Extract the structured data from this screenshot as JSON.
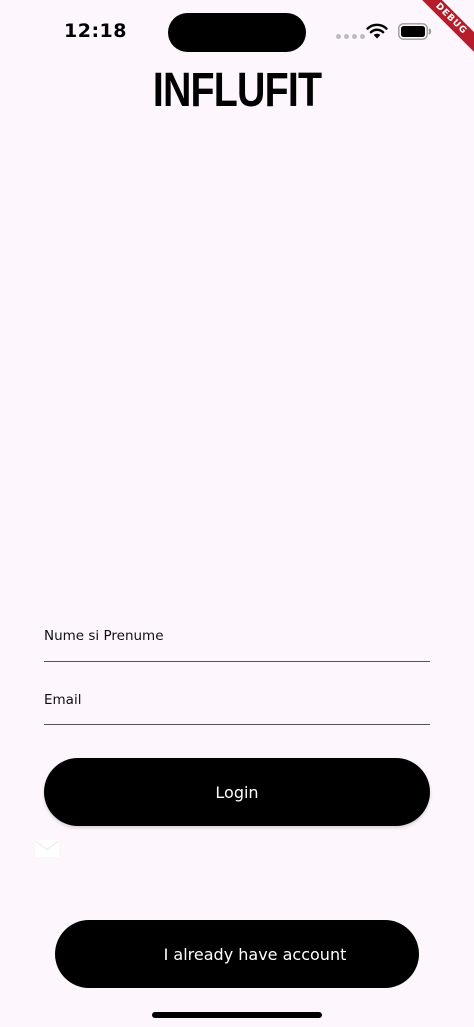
{
  "status_bar": {
    "time": "12:18"
  },
  "debug_banner": {
    "label": "DEBUG",
    "color": "#b71c2b"
  },
  "app": {
    "logo": "INFLUFIT"
  },
  "form": {
    "name_label": "Nume si Prenume",
    "name_value": "",
    "email_label": "Email",
    "email_value": ""
  },
  "buttons": {
    "login": "Login",
    "existing_account": "I already have account"
  },
  "colors": {
    "background": "#fdf6fc",
    "button": "#000000",
    "button_text": "#ffffff"
  },
  "icons": {
    "mail": "mail-icon",
    "wifi": "wifi-icon",
    "battery": "battery-icon"
  }
}
